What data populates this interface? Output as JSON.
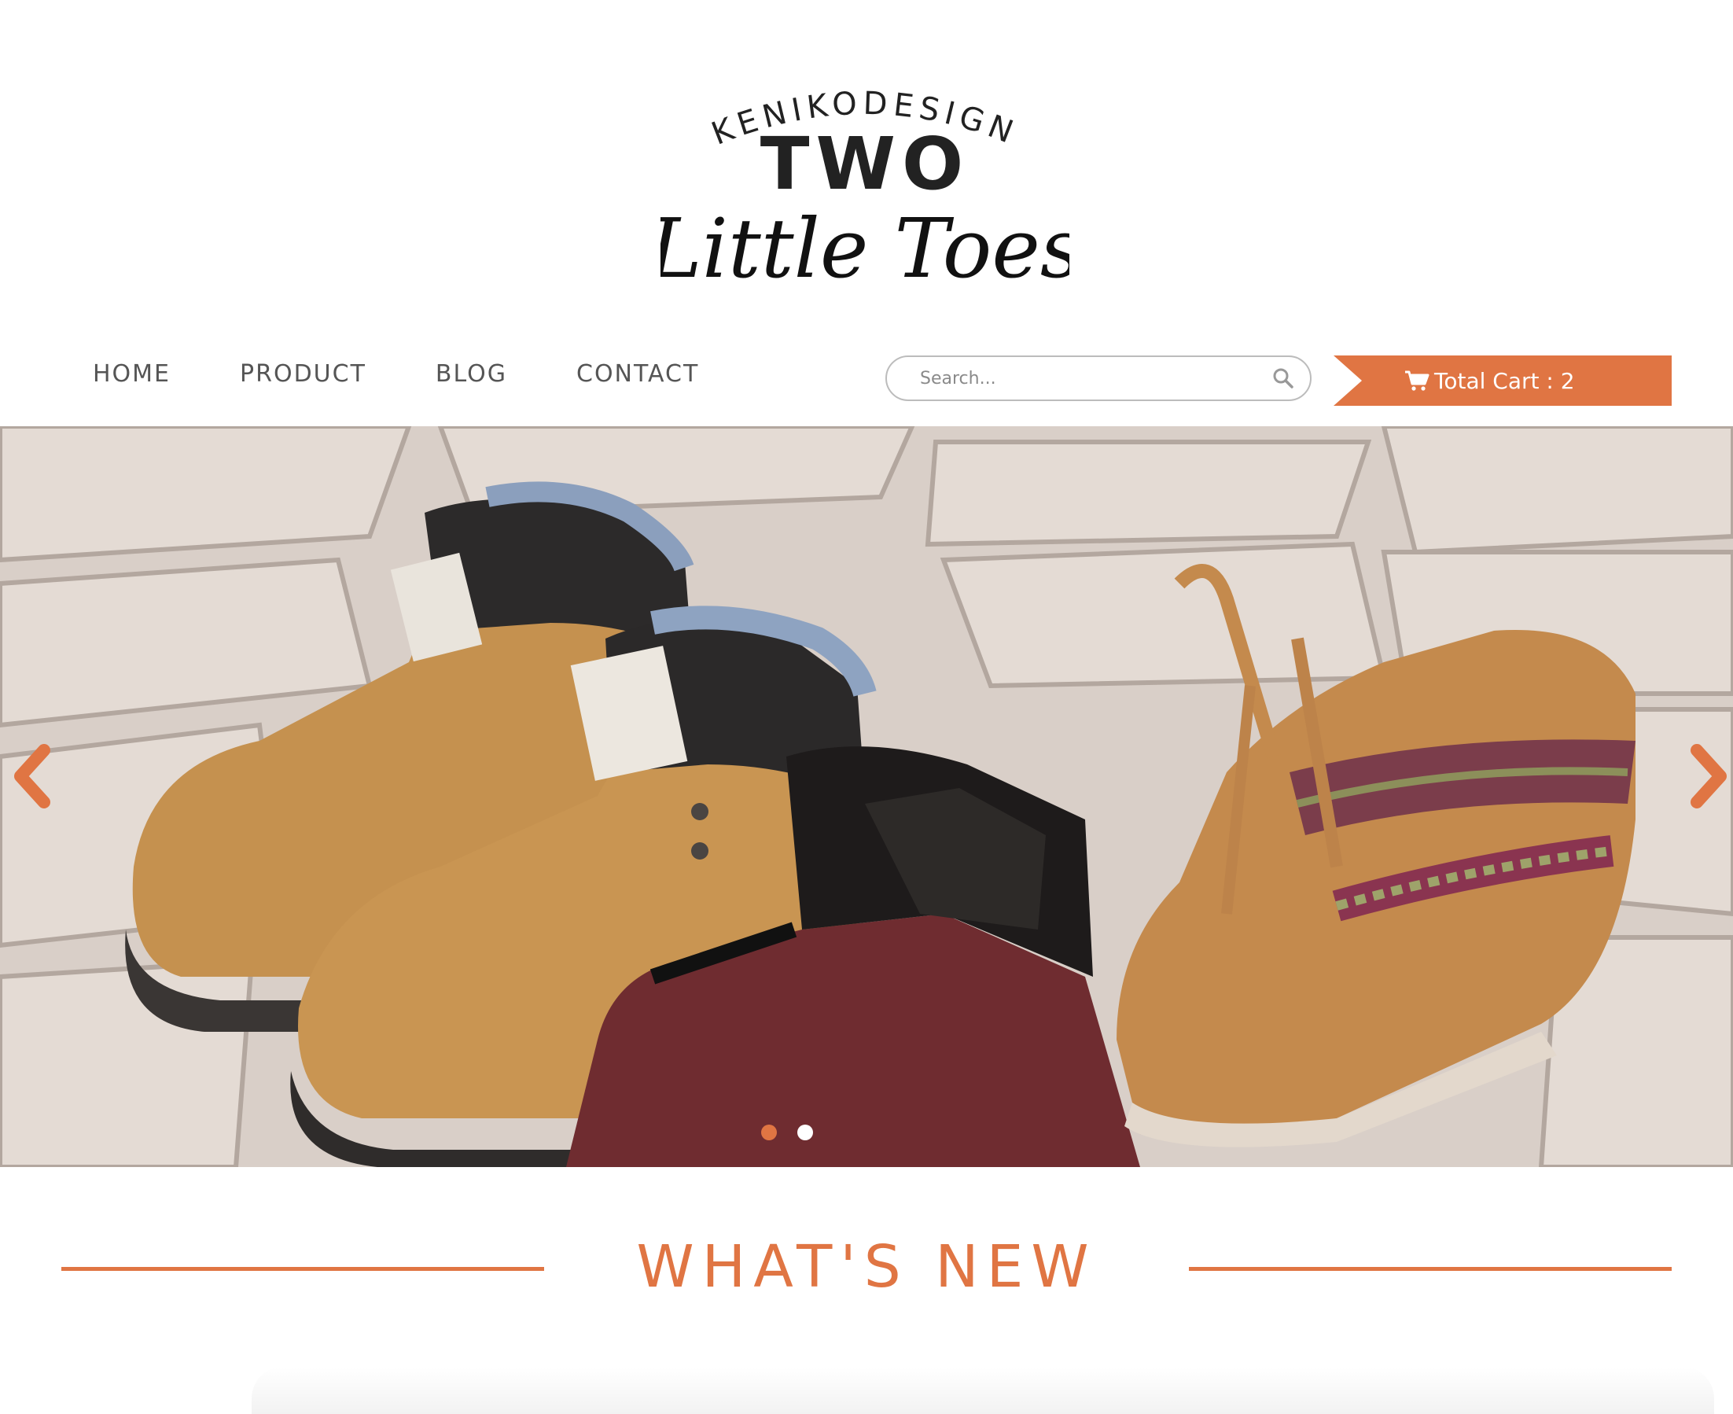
{
  "brand": {
    "top": "KENIKODESIGN",
    "middle": "TWO",
    "script": "Little Toes"
  },
  "nav": {
    "items": [
      {
        "label": "HOME"
      },
      {
        "label": "PRODUCT"
      },
      {
        "label": "BLOG"
      },
      {
        "label": "CONTACT"
      }
    ]
  },
  "search": {
    "placeholder": "Search...",
    "value": "",
    "icon": "search-icon"
  },
  "cart": {
    "label": "Total Cart : 2",
    "icon": "cart-icon"
  },
  "slider": {
    "prev_icon": "chevron-left-icon",
    "next_icon": "chevron-right-icon",
    "slides": 2,
    "active_slide": 1
  },
  "section": {
    "title": "WHAT'S NEW"
  },
  "colors": {
    "accent": "#e07543",
    "nav_text": "#555555",
    "dot_inactive": "#ffffff"
  }
}
